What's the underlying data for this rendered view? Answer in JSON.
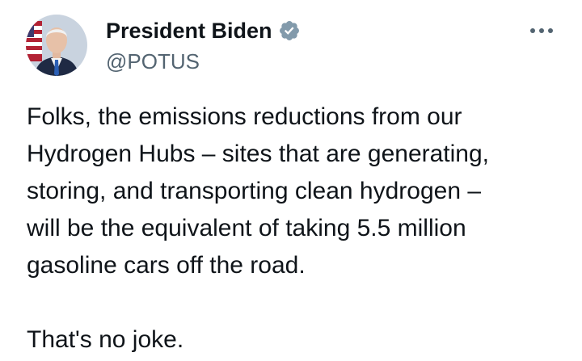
{
  "author": {
    "display_name": "President Biden",
    "handle": "@POTUS",
    "verified": true,
    "verified_badge_color": "#829aab"
  },
  "icons": {
    "verified": "verified-badge-icon",
    "more": "more-horizontal-icon"
  },
  "tweet": {
    "lines": [
      "Folks, the emissions reductions from our",
      "Hydrogen Hubs – sites that are generating,",
      "storing, and transporting clean hydrogen –",
      "will be the equivalent of taking 5.5 million",
      "gasoline cars off the road."
    ],
    "closing": "That's no joke."
  },
  "colors": {
    "text": "#0f1419",
    "secondary": "#536471",
    "background": "#ffffff"
  }
}
